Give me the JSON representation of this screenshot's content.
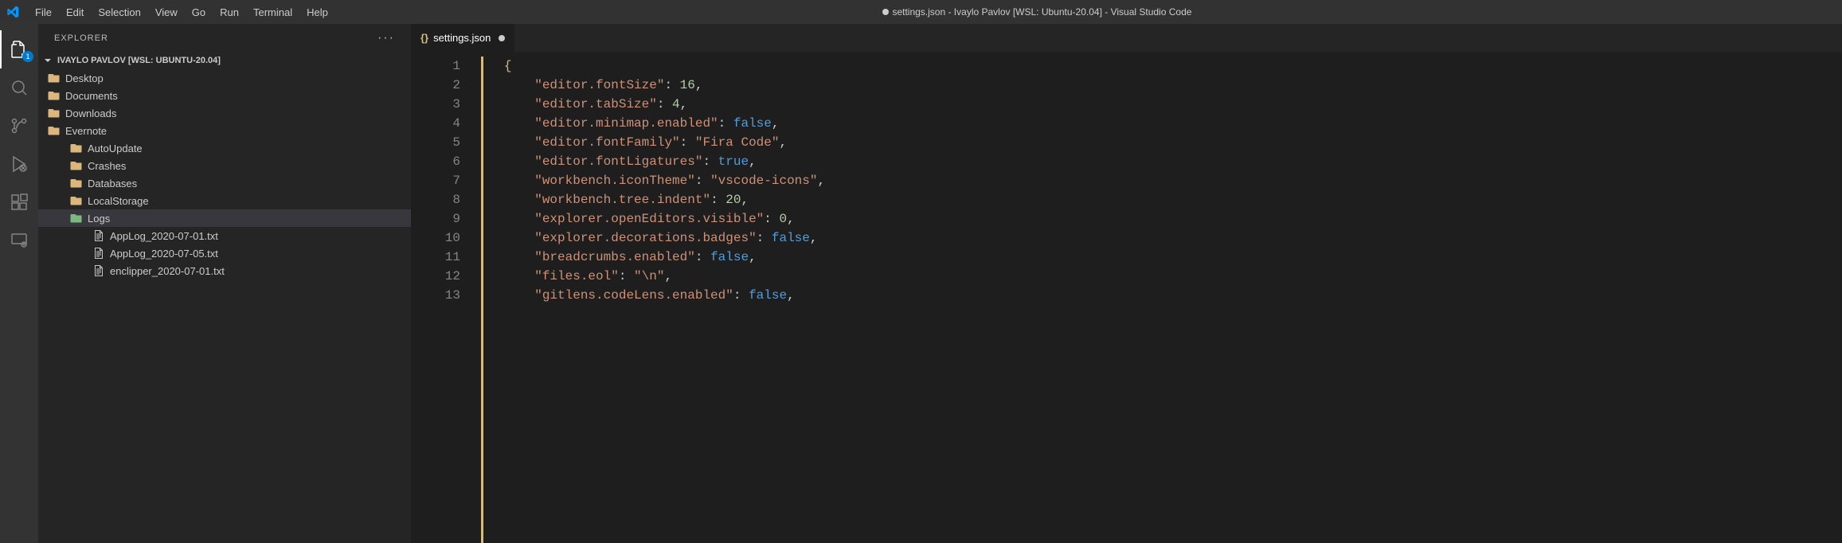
{
  "title": {
    "filename": "settings.json",
    "project": "Ivaylo Pavlov [WSL: Ubuntu-20.04]",
    "app": "Visual Studio Code",
    "full": "settings.json - Ivaylo Pavlov [WSL: Ubuntu-20.04] - Visual Studio Code"
  },
  "menubar": [
    "File",
    "Edit",
    "Selection",
    "View",
    "Go",
    "Run",
    "Terminal",
    "Help"
  ],
  "activity": {
    "explorer_badge": "1"
  },
  "sidebar": {
    "title": "EXPLORER",
    "project_label": "IVAYLO PAVLOV [WSL: UBUNTU-20.04]",
    "tree": [
      {
        "name": "Desktop",
        "type": "folder",
        "depth": 1
      },
      {
        "name": "Documents",
        "type": "folder",
        "depth": 1
      },
      {
        "name": "Downloads",
        "type": "folder",
        "depth": 1
      },
      {
        "name": "Evernote",
        "type": "folder",
        "depth": 1,
        "open": true
      },
      {
        "name": "AutoUpdate",
        "type": "folder",
        "depth": 2
      },
      {
        "name": "Crashes",
        "type": "folder",
        "depth": 2
      },
      {
        "name": "Databases",
        "type": "folder",
        "depth": 2
      },
      {
        "name": "LocalStorage",
        "type": "folder",
        "depth": 2
      },
      {
        "name": "Logs",
        "type": "folder",
        "depth": 2,
        "open": true,
        "green": true,
        "selected": true
      },
      {
        "name": "AppLog_2020-07-01.txt",
        "type": "file",
        "depth": 3
      },
      {
        "name": "AppLog_2020-07-05.txt",
        "type": "file",
        "depth": 3
      },
      {
        "name": "enclipper_2020-07-01.txt",
        "type": "file",
        "depth": 3
      }
    ]
  },
  "tabs": [
    {
      "label": "settings.json",
      "dirty": true,
      "icon": "{}"
    }
  ],
  "editor": {
    "line_numbers": [
      "1",
      "2",
      "3",
      "4",
      "5",
      "6",
      "7",
      "8",
      "9",
      "10",
      "11",
      "12",
      "13"
    ],
    "lines": [
      [
        [
          "brace",
          "{"
        ]
      ],
      [
        [
          "key",
          "\"editor.fontSize\""
        ],
        [
          "colon",
          ": "
        ],
        [
          "num",
          "16"
        ],
        [
          "punct",
          ","
        ]
      ],
      [
        [
          "key",
          "\"editor.tabSize\""
        ],
        [
          "colon",
          ": "
        ],
        [
          "num",
          "4"
        ],
        [
          "punct",
          ","
        ]
      ],
      [
        [
          "key",
          "\"editor.minimap.enabled\""
        ],
        [
          "colon",
          ": "
        ],
        [
          "bool",
          "false"
        ],
        [
          "punct",
          ","
        ]
      ],
      [
        [
          "key",
          "\"editor.fontFamily\""
        ],
        [
          "colon",
          ": "
        ],
        [
          "str",
          "\"Fira Code\""
        ],
        [
          "punct",
          ","
        ]
      ],
      [
        [
          "key",
          "\"editor.fontLigatures\""
        ],
        [
          "colon",
          ": "
        ],
        [
          "bool",
          "true"
        ],
        [
          "punct",
          ","
        ]
      ],
      [
        [
          "key",
          "\"workbench.iconTheme\""
        ],
        [
          "colon",
          ": "
        ],
        [
          "str",
          "\"vscode-icons\""
        ],
        [
          "punct",
          ","
        ]
      ],
      [
        [
          "key",
          "\"workbench.tree.indent\""
        ],
        [
          "colon",
          ": "
        ],
        [
          "num",
          "20"
        ],
        [
          "punct",
          ","
        ]
      ],
      [
        [
          "key",
          "\"explorer.openEditors.visible\""
        ],
        [
          "colon",
          ": "
        ],
        [
          "num",
          "0"
        ],
        [
          "punct",
          ","
        ]
      ],
      [
        [
          "key",
          "\"explorer.decorations.badges\""
        ],
        [
          "colon",
          ": "
        ],
        [
          "bool",
          "false"
        ],
        [
          "punct",
          ","
        ]
      ],
      [
        [
          "key",
          "\"breadcrumbs.enabled\""
        ],
        [
          "colon",
          ": "
        ],
        [
          "bool",
          "false"
        ],
        [
          "punct",
          ","
        ]
      ],
      [
        [
          "key",
          "\"files.eol\""
        ],
        [
          "colon",
          ": "
        ],
        [
          "str",
          "\"\\n\""
        ],
        [
          "punct",
          ","
        ]
      ],
      [
        [
          "key",
          "\"gitlens.codeLens.enabled\""
        ],
        [
          "colon",
          ": "
        ],
        [
          "bool",
          "false"
        ],
        [
          "punct",
          ","
        ]
      ]
    ]
  }
}
